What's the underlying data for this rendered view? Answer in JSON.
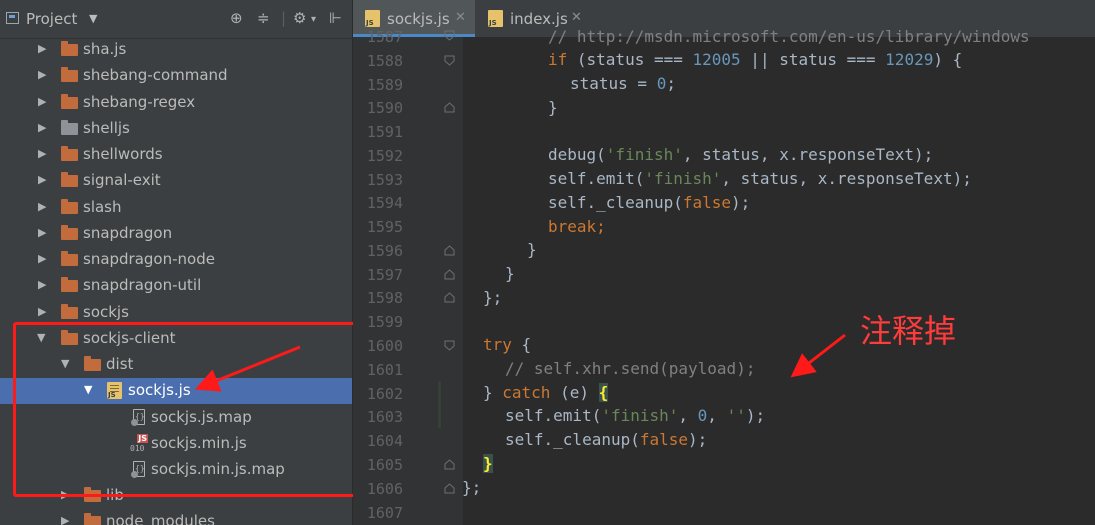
{
  "sidebar": {
    "title": "Project",
    "tree": [
      {
        "label": "sha.js"
      },
      {
        "label": "shebang-command"
      },
      {
        "label": "shebang-regex"
      },
      {
        "label": "shelljs"
      },
      {
        "label": "shellwords"
      },
      {
        "label": "signal-exit"
      },
      {
        "label": "slash"
      },
      {
        "label": "snapdragon"
      },
      {
        "label": "snapdragon-node"
      },
      {
        "label": "snapdragon-util"
      },
      {
        "label": "sockjs"
      },
      {
        "label": "sockjs-client"
      },
      {
        "label": "dist"
      },
      {
        "label": "sockjs.js"
      },
      {
        "label": "sockjs.js.map"
      },
      {
        "label": "sockjs.min.js"
      },
      {
        "label": "sockjs.min.js.map"
      },
      {
        "label": "lib"
      },
      {
        "label": "node_modules"
      }
    ]
  },
  "tabs": [
    {
      "label": "sockjs.js"
    },
    {
      "label": "index.js"
    }
  ],
  "editor": {
    "line_numbers": [
      "1587",
      "1588",
      "1589",
      "1590",
      "1591",
      "1592",
      "1593",
      "1594",
      "1595",
      "1596",
      "1597",
      "1598",
      "1599",
      "1600",
      "1601",
      "1602",
      "1603",
      "1604",
      "1605",
      "1606",
      "1607"
    ],
    "lines": {
      "l1587": "// http://msdn.microsoft.com/en-us/library/windows",
      "l1588": [
        "if",
        " (status === ",
        "12005",
        " || status === ",
        "12029",
        ") {"
      ],
      "l1589": [
        "status = ",
        "0",
        ";"
      ],
      "l1590": "}",
      "l1592": [
        "debug(",
        "'finish'",
        ", status, x.responseText);"
      ],
      "l1593": [
        "self.emit(",
        "'finish'",
        ", status, x.responseText);"
      ],
      "l1594": [
        "self._cleanup(",
        "false",
        ");"
      ],
      "l1595": [
        "break",
        ";"
      ],
      "l1596": "}",
      "l1597": "}",
      "l1598": "};",
      "l1600": [
        "try",
        " {"
      ],
      "l1601": "// self.xhr.send(payload);",
      "l1602": [
        "} ",
        "catch",
        " (e) ",
        "{"
      ],
      "l1603": [
        "self.emit(",
        "'finish'",
        ", ",
        "0",
        ", ",
        "''",
        ");"
      ],
      "l1604": [
        "self._cleanup(",
        "false",
        ");"
      ],
      "l1605": "}",
      "l1606": "};"
    }
  },
  "annotation": {
    "label": "注释掉"
  },
  "colors": {
    "annotation": "#ff1a1a",
    "selection": "#4b6eaf",
    "folder": "#c26b3d"
  },
  "icons": {
    "project": "project-icon",
    "folder": "folder-icon",
    "js_file": "js-file-icon",
    "map_file": "map-file-icon"
  }
}
